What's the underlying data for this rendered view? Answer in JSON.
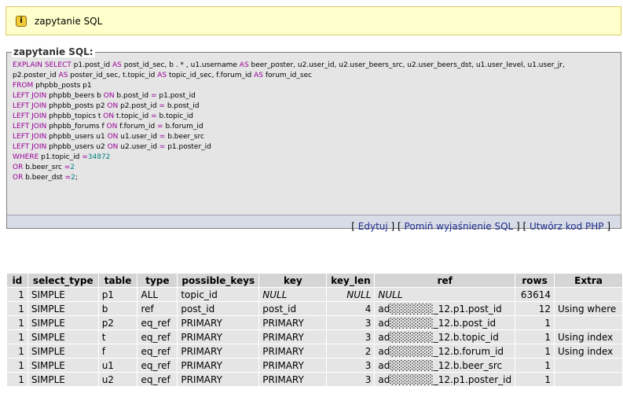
{
  "notice": {
    "text": "zapytanie SQL"
  },
  "sql_box": {
    "legend": "zapytanie SQL:",
    "lines": [
      [
        {
          "k": "EXPLAIN SELECT"
        },
        {
          "t": " p1.post_id "
        },
        {
          "k": "AS"
        },
        {
          "t": " post_id_sec, b . * , u1.username "
        },
        {
          "k": "AS"
        },
        {
          "t": " beer_poster, u2.user_id, u2.user_beers_src, u2.user_beers_dst, u1.user_level, u1.user_jr,"
        }
      ],
      [
        {
          "t": "p2.poster_id "
        },
        {
          "k": "AS"
        },
        {
          "t": " poster_id_sec, t.topic_id "
        },
        {
          "k": "AS"
        },
        {
          "t": " topic_id_sec, f.forum_id "
        },
        {
          "k": "AS"
        },
        {
          "t": " forum_id_sec"
        }
      ],
      [
        {
          "k": "FROM"
        },
        {
          "t": " phpbb_posts p1"
        }
      ],
      [
        {
          "k": "LEFT JOIN"
        },
        {
          "t": " phpbb_beers b "
        },
        {
          "k": "ON"
        },
        {
          "t": " b.post_id "
        },
        {
          "k": "="
        },
        {
          "t": " p1.post_id"
        }
      ],
      [
        {
          "k": "LEFT JOIN"
        },
        {
          "t": " phpbb_posts p2 "
        },
        {
          "k": "ON"
        },
        {
          "t": " p2.post_id "
        },
        {
          "k": "="
        },
        {
          "t": " b.post_id"
        }
      ],
      [
        {
          "k": "LEFT JOIN"
        },
        {
          "t": " phpbb_topics t "
        },
        {
          "k": "ON"
        },
        {
          "t": " t.topic_id "
        },
        {
          "k": "="
        },
        {
          "t": " b.topic_id"
        }
      ],
      [
        {
          "k": "LEFT JOIN"
        },
        {
          "t": " phpbb_forums f "
        },
        {
          "k": "ON"
        },
        {
          "t": " f.forum_id "
        },
        {
          "k": "="
        },
        {
          "t": " b.forum_id"
        }
      ],
      [
        {
          "k": "LEFT JOIN"
        },
        {
          "t": " phpbb_users u1 "
        },
        {
          "k": "ON"
        },
        {
          "t": " u1.user_id "
        },
        {
          "k": "="
        },
        {
          "t": " b.beer_src"
        }
      ],
      [
        {
          "k": "LEFT JOIN"
        },
        {
          "t": " phpbb_users u2 "
        },
        {
          "k": "ON"
        },
        {
          "t": " u2.user_id "
        },
        {
          "k": "="
        },
        {
          "t": " p1.poster_id"
        }
      ],
      [
        {
          "k": "WHERE"
        },
        {
          "t": " p1.topic_id "
        },
        {
          "k": "="
        },
        {
          "n": "34872"
        }
      ],
      [
        {
          "k": "OR"
        },
        {
          "t": " b.beer_src "
        },
        {
          "k": "="
        },
        {
          "n": "2"
        }
      ],
      [
        {
          "k": "OR"
        },
        {
          "t": " b.beer_dst "
        },
        {
          "k": "="
        },
        {
          "n": "2"
        },
        {
          "t": ";"
        }
      ]
    ],
    "actions": {
      "edit": "Edytuj",
      "skip_explain": "Pomiń wyjaśnienie SQL",
      "create_php": "Utwórz kod PHP"
    }
  },
  "explain_table": {
    "headers": [
      "id",
      "select_type",
      "table",
      "type",
      "possible_keys",
      "key",
      "key_len",
      "ref",
      "rows",
      "Extra"
    ],
    "rows": [
      [
        "1",
        "SIMPLE",
        "p1",
        "ALL",
        "topic_id",
        "NULL",
        "NULL",
        "NULL",
        "63614",
        ""
      ],
      [
        "1",
        "SIMPLE",
        "b",
        "ref",
        "post_id",
        "post_id",
        "4",
        "ad░░░░░░_12.p1.post_id",
        "12",
        "Using where"
      ],
      [
        "1",
        "SIMPLE",
        "p2",
        "eq_ref",
        "PRIMARY",
        "PRIMARY",
        "3",
        "ad░░░░░░_12.b.post_id",
        "1",
        ""
      ],
      [
        "1",
        "SIMPLE",
        "t",
        "eq_ref",
        "PRIMARY",
        "PRIMARY",
        "3",
        "ad░░░░░░_12.b.topic_id",
        "1",
        "Using index"
      ],
      [
        "1",
        "SIMPLE",
        "f",
        "eq_ref",
        "PRIMARY",
        "PRIMARY",
        "2",
        "ad░░░░░░_12.b.forum_id",
        "1",
        "Using index"
      ],
      [
        "1",
        "SIMPLE",
        "u1",
        "eq_ref",
        "PRIMARY",
        "PRIMARY",
        "3",
        "ad░░░░░░_12.b.beer_src",
        "1",
        ""
      ],
      [
        "1",
        "SIMPLE",
        "u2",
        "eq_ref",
        "PRIMARY",
        "PRIMARY",
        "3",
        "ad░░░░░░_12.p1.poster_id",
        "1",
        ""
      ]
    ]
  }
}
